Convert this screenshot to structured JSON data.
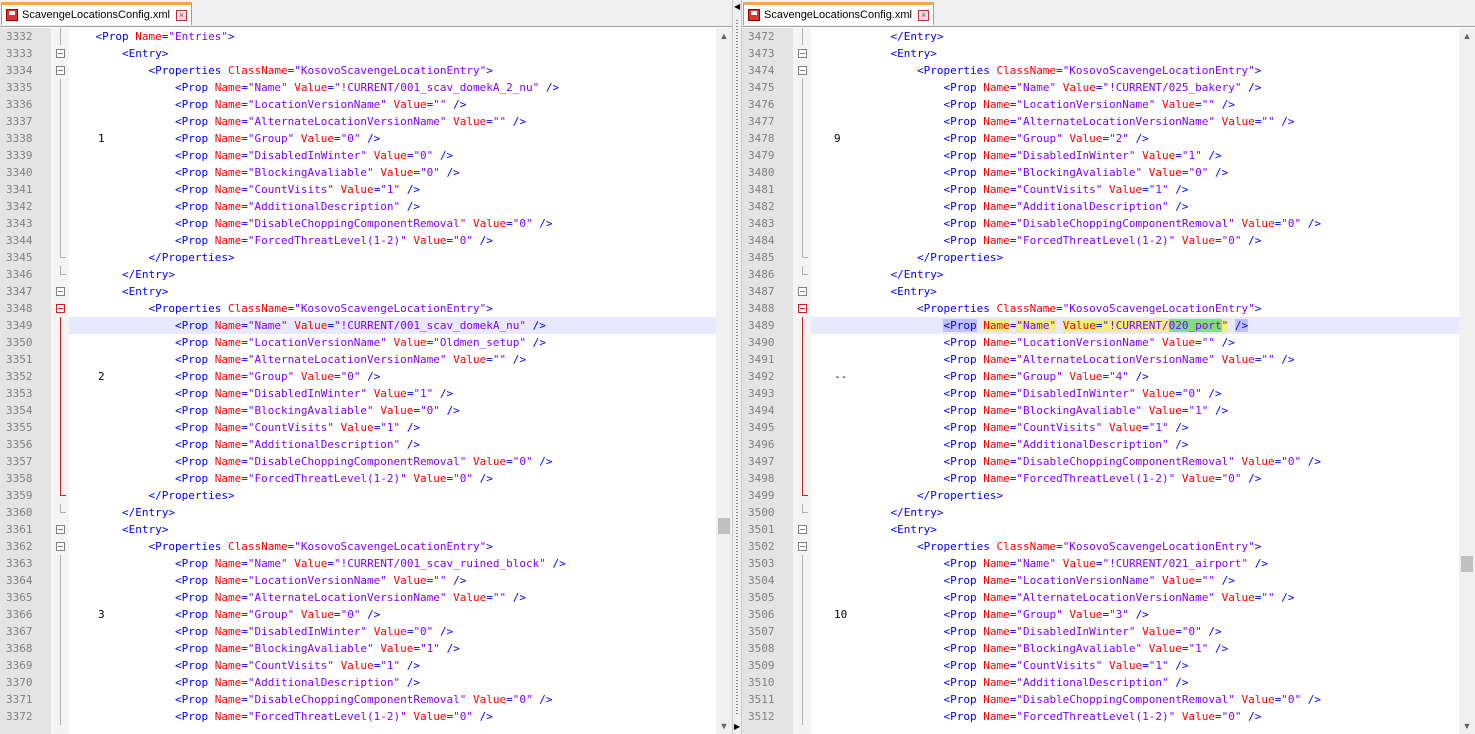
{
  "tabs": {
    "left": {
      "title": "ScavengeLocationsConfig.xml"
    },
    "right": {
      "title": "ScavengeLocationsConfig.xml"
    }
  },
  "left_editor": {
    "lines": [
      {
        "n": "3332",
        "indent": 5,
        "kind": "open-prop-entries",
        "fold": "v",
        "note": ""
      },
      {
        "n": "3333",
        "indent": 6,
        "kind": "entry",
        "fold": "box",
        "note": ""
      },
      {
        "n": "3334",
        "indent": 7,
        "kind": "props",
        "cls": "KosovoScavengeLocationEntry",
        "fold": "box",
        "note": ""
      },
      {
        "n": "3335",
        "indent": 8,
        "kind": "prop",
        "name": "Name",
        "value": "!CURRENT/001_scav_domekA_2_nu",
        "fold": "v",
        "note": ""
      },
      {
        "n": "3336",
        "indent": 8,
        "kind": "prop",
        "name": "LocationVersionName",
        "value": "",
        "fold": "v",
        "note": ""
      },
      {
        "n": "3337",
        "indent": 8,
        "kind": "prop",
        "name": "AlternateLocationVersionName",
        "value": "",
        "fold": "v",
        "note": ""
      },
      {
        "n": "3338",
        "indent": 8,
        "kind": "prop",
        "name": "Group",
        "value": "0",
        "fold": "v",
        "note": "1"
      },
      {
        "n": "3339",
        "indent": 8,
        "kind": "prop",
        "name": "DisabledInWinter",
        "value": "0",
        "fold": "v",
        "note": ""
      },
      {
        "n": "3340",
        "indent": 8,
        "kind": "prop",
        "name": "BlockingAvaliable",
        "value": "0",
        "fold": "v",
        "note": ""
      },
      {
        "n": "3341",
        "indent": 8,
        "kind": "prop",
        "name": "CountVisits",
        "value": "1",
        "fold": "v",
        "note": ""
      },
      {
        "n": "3342",
        "indent": 8,
        "kind": "prop-novalue",
        "name": "AdditionalDescription",
        "fold": "v",
        "note": ""
      },
      {
        "n": "3343",
        "indent": 8,
        "kind": "prop",
        "name": "DisableChoppingComponentRemoval",
        "value": "0",
        "fold": "v",
        "note": ""
      },
      {
        "n": "3344",
        "indent": 8,
        "kind": "prop",
        "name": "ForcedThreatLevel(1-2)",
        "value": "0",
        "fold": "v",
        "note": ""
      },
      {
        "n": "3345",
        "indent": 7,
        "kind": "close-props",
        "fold": "end",
        "note": ""
      },
      {
        "n": "3346",
        "indent": 6,
        "kind": "close-entry",
        "fold": "end",
        "note": ""
      },
      {
        "n": "3347",
        "indent": 6,
        "kind": "entry",
        "fold": "box",
        "note": ""
      },
      {
        "n": "3348",
        "indent": 7,
        "kind": "props",
        "cls": "KosovoScavengeLocationEntry",
        "fold": "box-red",
        "note": ""
      },
      {
        "n": "3349",
        "indent": 8,
        "kind": "prop",
        "name": "Name",
        "value": "!CURRENT/001_scav_domekA_nu",
        "fold": "v-red",
        "note": "",
        "hl": true
      },
      {
        "n": "3350",
        "indent": 8,
        "kind": "prop",
        "name": "LocationVersionName",
        "value": "Oldmen_setup",
        "fold": "v-red",
        "note": ""
      },
      {
        "n": "3351",
        "indent": 8,
        "kind": "prop",
        "name": "AlternateLocationVersionName",
        "value": "",
        "fold": "v-red",
        "note": ""
      },
      {
        "n": "3352",
        "indent": 8,
        "kind": "prop",
        "name": "Group",
        "value": "0",
        "fold": "v-red",
        "note": "2"
      },
      {
        "n": "3353",
        "indent": 8,
        "kind": "prop",
        "name": "DisabledInWinter",
        "value": "1",
        "fold": "v-red",
        "note": ""
      },
      {
        "n": "3354",
        "indent": 8,
        "kind": "prop",
        "name": "BlockingAvaliable",
        "value": "0",
        "fold": "v-red",
        "note": ""
      },
      {
        "n": "3355",
        "indent": 8,
        "kind": "prop",
        "name": "CountVisits",
        "value": "1",
        "fold": "v-red",
        "note": ""
      },
      {
        "n": "3356",
        "indent": 8,
        "kind": "prop-novalue",
        "name": "AdditionalDescription",
        "fold": "v-red",
        "note": ""
      },
      {
        "n": "3357",
        "indent": 8,
        "kind": "prop",
        "name": "DisableChoppingComponentRemoval",
        "value": "0",
        "fold": "v-red",
        "note": ""
      },
      {
        "n": "3358",
        "indent": 8,
        "kind": "prop",
        "name": "ForcedThreatLevel(1-2)",
        "value": "0",
        "fold": "v-red",
        "note": ""
      },
      {
        "n": "3359",
        "indent": 7,
        "kind": "close-props",
        "fold": "end-red",
        "note": ""
      },
      {
        "n": "3360",
        "indent": 6,
        "kind": "close-entry",
        "fold": "end",
        "note": ""
      },
      {
        "n": "3361",
        "indent": 6,
        "kind": "entry",
        "fold": "box",
        "note": ""
      },
      {
        "n": "3362",
        "indent": 7,
        "kind": "props",
        "cls": "KosovoScavengeLocationEntry",
        "fold": "box",
        "note": ""
      },
      {
        "n": "3363",
        "indent": 8,
        "kind": "prop",
        "name": "Name",
        "value": "!CURRENT/001_scav_ruined_block",
        "fold": "v",
        "note": ""
      },
      {
        "n": "3364",
        "indent": 8,
        "kind": "prop",
        "name": "LocationVersionName",
        "value": "",
        "fold": "v",
        "note": ""
      },
      {
        "n": "3365",
        "indent": 8,
        "kind": "prop",
        "name": "AlternateLocationVersionName",
        "value": "",
        "fold": "v",
        "note": ""
      },
      {
        "n": "3366",
        "indent": 8,
        "kind": "prop",
        "name": "Group",
        "value": "0",
        "fold": "v",
        "note": "3"
      },
      {
        "n": "3367",
        "indent": 8,
        "kind": "prop",
        "name": "DisabledInWinter",
        "value": "0",
        "fold": "v",
        "note": ""
      },
      {
        "n": "3368",
        "indent": 8,
        "kind": "prop",
        "name": "BlockingAvaliable",
        "value": "1",
        "fold": "v",
        "note": ""
      },
      {
        "n": "3369",
        "indent": 8,
        "kind": "prop",
        "name": "CountVisits",
        "value": "1",
        "fold": "v",
        "note": ""
      },
      {
        "n": "3370",
        "indent": 8,
        "kind": "prop-novalue",
        "name": "AdditionalDescription",
        "fold": "v",
        "note": ""
      },
      {
        "n": "3371",
        "indent": 8,
        "kind": "prop",
        "name": "DisableChoppingComponentRemoval",
        "value": "0",
        "fold": "v",
        "note": ""
      },
      {
        "n": "3372",
        "indent": 8,
        "kind": "prop",
        "name": "ForcedThreatLevel(1-2)",
        "value": "0",
        "fold": "v",
        "note": ""
      }
    ]
  },
  "right_editor": {
    "lines": [
      {
        "n": "3472",
        "indent": 7,
        "kind": "close-entry",
        "fold": "v",
        "note": ""
      },
      {
        "n": "3473",
        "indent": 7,
        "kind": "entry",
        "fold": "box",
        "note": ""
      },
      {
        "n": "3474",
        "indent": 8,
        "kind": "props",
        "cls": "KosovoScavengeLocationEntry",
        "fold": "box",
        "note": ""
      },
      {
        "n": "3475",
        "indent": 9,
        "kind": "prop",
        "name": "Name",
        "value": "!CURRENT/025_bakery",
        "fold": "v",
        "note": ""
      },
      {
        "n": "3476",
        "indent": 9,
        "kind": "prop",
        "name": "LocationVersionName",
        "value": "",
        "fold": "v",
        "note": ""
      },
      {
        "n": "3477",
        "indent": 9,
        "kind": "prop",
        "name": "AlternateLocationVersionName",
        "value": "",
        "fold": "v",
        "note": ""
      },
      {
        "n": "3478",
        "indent": 9,
        "kind": "prop",
        "name": "Group",
        "value": "2",
        "fold": "v",
        "note": "9"
      },
      {
        "n": "3479",
        "indent": 9,
        "kind": "prop",
        "name": "DisabledInWinter",
        "value": "1",
        "fold": "v",
        "note": ""
      },
      {
        "n": "3480",
        "indent": 9,
        "kind": "prop",
        "name": "BlockingAvaliable",
        "value": "0",
        "fold": "v",
        "note": ""
      },
      {
        "n": "3481",
        "indent": 9,
        "kind": "prop",
        "name": "CountVisits",
        "value": "1",
        "fold": "v",
        "note": ""
      },
      {
        "n": "3482",
        "indent": 9,
        "kind": "prop-novalue",
        "name": "AdditionalDescription",
        "fold": "v",
        "note": ""
      },
      {
        "n": "3483",
        "indent": 9,
        "kind": "prop",
        "name": "DisableChoppingComponentRemoval",
        "value": "0",
        "fold": "v",
        "note": ""
      },
      {
        "n": "3484",
        "indent": 9,
        "kind": "prop",
        "name": "ForcedThreatLevel(1-2)",
        "value": "0",
        "fold": "v",
        "note": ""
      },
      {
        "n": "3485",
        "indent": 8,
        "kind": "close-props",
        "fold": "end",
        "note": ""
      },
      {
        "n": "3486",
        "indent": 7,
        "kind": "close-entry",
        "fold": "end",
        "note": ""
      },
      {
        "n": "3487",
        "indent": 7,
        "kind": "entry",
        "fold": "box",
        "note": ""
      },
      {
        "n": "3488",
        "indent": 8,
        "kind": "props",
        "cls": "KosovoScavengeLocationEntry",
        "fold": "box-red",
        "note": ""
      },
      {
        "n": "3489",
        "indent": 9,
        "kind": "prop-selected",
        "name": "Name",
        "value_a": "!CURRENT/",
        "value_b": "020_port",
        "fold": "v-red",
        "note": "",
        "hl": true
      },
      {
        "n": "3490",
        "indent": 9,
        "kind": "prop",
        "name": "LocationVersionName",
        "value": "",
        "fold": "v-red",
        "note": ""
      },
      {
        "n": "3491",
        "indent": 9,
        "kind": "prop",
        "name": "AlternateLocationVersionName",
        "value": "",
        "fold": "v-red",
        "note": ""
      },
      {
        "n": "3492",
        "indent": 9,
        "kind": "prop",
        "name": "Group",
        "value": "4",
        "fold": "v-red",
        "note": "--"
      },
      {
        "n": "3493",
        "indent": 9,
        "kind": "prop",
        "name": "DisabledInWinter",
        "value": "0",
        "fold": "v-red",
        "note": ""
      },
      {
        "n": "3494",
        "indent": 9,
        "kind": "prop",
        "name": "BlockingAvaliable",
        "value": "1",
        "fold": "v-red",
        "note": ""
      },
      {
        "n": "3495",
        "indent": 9,
        "kind": "prop",
        "name": "CountVisits",
        "value": "1",
        "fold": "v-red",
        "note": ""
      },
      {
        "n": "3496",
        "indent": 9,
        "kind": "prop-novalue",
        "name": "AdditionalDescription",
        "fold": "v-red",
        "note": ""
      },
      {
        "n": "3497",
        "indent": 9,
        "kind": "prop",
        "name": "DisableChoppingComponentRemoval",
        "value": "0",
        "fold": "v-red",
        "note": ""
      },
      {
        "n": "3498",
        "indent": 9,
        "kind": "prop",
        "name": "ForcedThreatLevel(1-2)",
        "value": "0",
        "fold": "v-red",
        "note": ""
      },
      {
        "n": "3499",
        "indent": 8,
        "kind": "close-props",
        "fold": "end-red",
        "note": ""
      },
      {
        "n": "3500",
        "indent": 7,
        "kind": "close-entry",
        "fold": "end",
        "note": ""
      },
      {
        "n": "3501",
        "indent": 7,
        "kind": "entry",
        "fold": "box",
        "note": ""
      },
      {
        "n": "3502",
        "indent": 8,
        "kind": "props",
        "cls": "KosovoScavengeLocationEntry",
        "fold": "box",
        "note": ""
      },
      {
        "n": "3503",
        "indent": 9,
        "kind": "prop",
        "name": "Name",
        "value": "!CURRENT/021_airport",
        "fold": "v",
        "note": ""
      },
      {
        "n": "3504",
        "indent": 9,
        "kind": "prop",
        "name": "LocationVersionName",
        "value": "",
        "fold": "v",
        "note": ""
      },
      {
        "n": "3505",
        "indent": 9,
        "kind": "prop",
        "name": "AlternateLocationVersionName",
        "value": "",
        "fold": "v",
        "note": ""
      },
      {
        "n": "3506",
        "indent": 9,
        "kind": "prop",
        "name": "Group",
        "value": "3",
        "fold": "v",
        "note": "10"
      },
      {
        "n": "3507",
        "indent": 9,
        "kind": "prop",
        "name": "DisabledInWinter",
        "value": "0",
        "fold": "v",
        "note": ""
      },
      {
        "n": "3508",
        "indent": 9,
        "kind": "prop",
        "name": "BlockingAvaliable",
        "value": "1",
        "fold": "v",
        "note": ""
      },
      {
        "n": "3509",
        "indent": 9,
        "kind": "prop",
        "name": "CountVisits",
        "value": "1",
        "fold": "v",
        "note": ""
      },
      {
        "n": "3510",
        "indent": 9,
        "kind": "prop-novalue",
        "name": "AdditionalDescription",
        "fold": "v",
        "note": ""
      },
      {
        "n": "3511",
        "indent": 9,
        "kind": "prop",
        "name": "DisableChoppingComponentRemoval",
        "value": "0",
        "fold": "v",
        "note": ""
      },
      {
        "n": "3512",
        "indent": 9,
        "kind": "prop",
        "name": "ForcedThreatLevel(1-2)",
        "value": "0",
        "fold": "v",
        "note": ""
      }
    ]
  },
  "colors": {
    "tag": "#0000ff",
    "attr": "#ff0000",
    "value": "#8000ff",
    "tab_accent": "#faa54a",
    "change_marker": "#cc2222"
  },
  "icons": [
    "save-icon",
    "close-tab-icon",
    "fold-toggle-icon",
    "scroll-up-arrow-icon",
    "scroll-down-arrow-icon",
    "splitter-arrow-icon"
  ]
}
